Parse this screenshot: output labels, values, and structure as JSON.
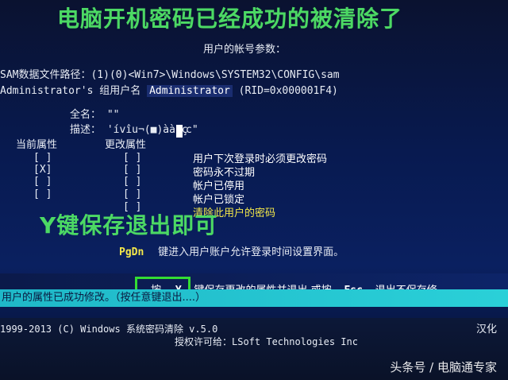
{
  "annotations": {
    "top": "电脑开机密码已经成功的被清除了",
    "middle": "Y键保存退出即可"
  },
  "header": {
    "title": "用户的帐号参数："
  },
  "sam": {
    "path_line": "SAM数据文件路径：(1)(0)<Win7>\\Windows\\SYSTEM32\\CONFIG\\sam",
    "group_prefix": "Administrator's 组用户名",
    "group_value": "Administrator",
    "rid": "(RID=0x000001F4)"
  },
  "account": {
    "fullname_label": "全名：",
    "fullname_value": "\"\"",
    "desc_label": "描述：",
    "desc_value": "'ívîu¬(■)àà ç",
    "desc_tail": "c\"",
    "current_attr_label": "当前属性",
    "change_attr_label": "更改属性"
  },
  "options": [
    {
      "current": "[ ]",
      "change": "[ ]",
      "label": "用户下次登录时必须更改密码"
    },
    {
      "current": "[X]",
      "change": "[ ]",
      "label": "密码永不过期"
    },
    {
      "current": "[ ]",
      "change": "[ ]",
      "label": "帐户已停用"
    },
    {
      "current": "[ ]",
      "change": "[ ]",
      "label": "帐户已锁定"
    },
    {
      "current": "",
      "change": "[ ]",
      "label": "清除此用户的密码"
    }
  ],
  "pgdn": {
    "key": "PgDn",
    "text": "键进入用户账户允许登录时间设置界面。"
  },
  "prompt": {
    "press": "按",
    "key_y": "Y",
    "save_text": "键保存更改的属性并退出 或按",
    "key_esc": "Esc",
    "esc_text": "退出不保存修"
  },
  "status": {
    "text": "用户的属性已成功修改。（按任意键退出....）"
  },
  "footer": {
    "copyright": "1999-2013 (C) Windows 系统密码清除 v.5.0",
    "right_label": "汉化",
    "license": "授权许可给：LSoft Technologies Inc"
  },
  "watermark": "头条号 / 电脑通专家",
  "colors": {
    "annotation_green": "#4cd964",
    "status_cyan": "#2ad0d8",
    "highlight_green": "#33dd33",
    "yellow_text": "#f4e84a"
  }
}
